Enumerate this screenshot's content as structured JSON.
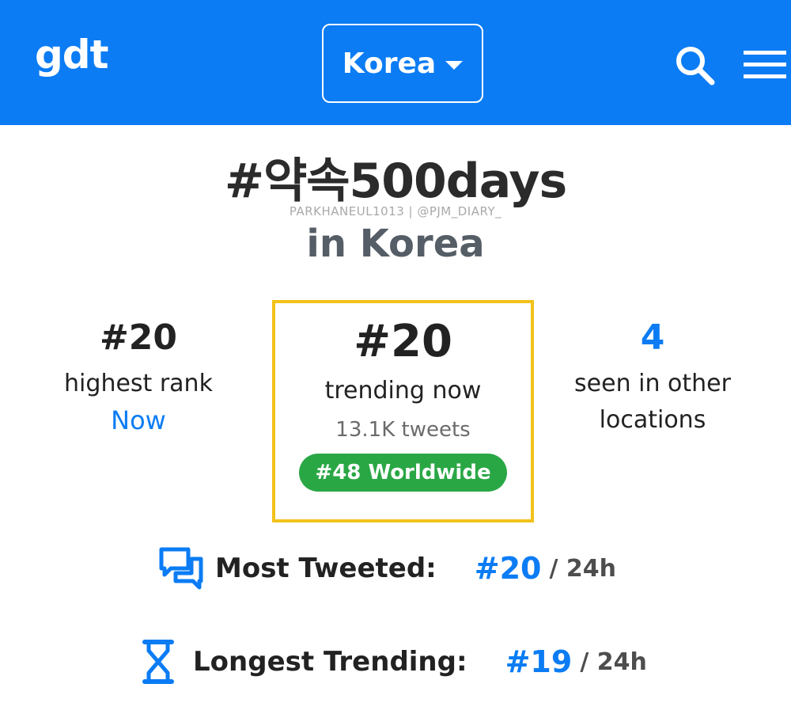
{
  "header": {
    "logo": "gdt",
    "country": "Korea",
    "icons": [
      "search-icon",
      "menu-icon"
    ]
  },
  "topic": {
    "hashtag": "#약속500days",
    "watermark": "PARKHANEUL1013 | @PJM_DIARY_",
    "location": "in Korea"
  },
  "stats": {
    "highest": {
      "value": "#20",
      "label": "highest rank",
      "sub": "Now"
    },
    "trending": {
      "value": "#20",
      "label": "trending now",
      "tweets": "13.1K tweets",
      "badge": "#48 Worldwide"
    },
    "other": {
      "value": "4",
      "label_line1": "seen in other",
      "label_line2": "locations"
    }
  },
  "rankings": {
    "most_tweeted": {
      "label": "Most Tweeted:",
      "rank": "#20",
      "period": "/ 24h"
    },
    "longest_trending": {
      "label": "Longest Trending:",
      "rank": "#19",
      "period": "/ 24h"
    }
  },
  "colors": {
    "accent": "#0b7cf4",
    "highlight_border": "#f2c21a",
    "badge_green": "#2aa745"
  }
}
